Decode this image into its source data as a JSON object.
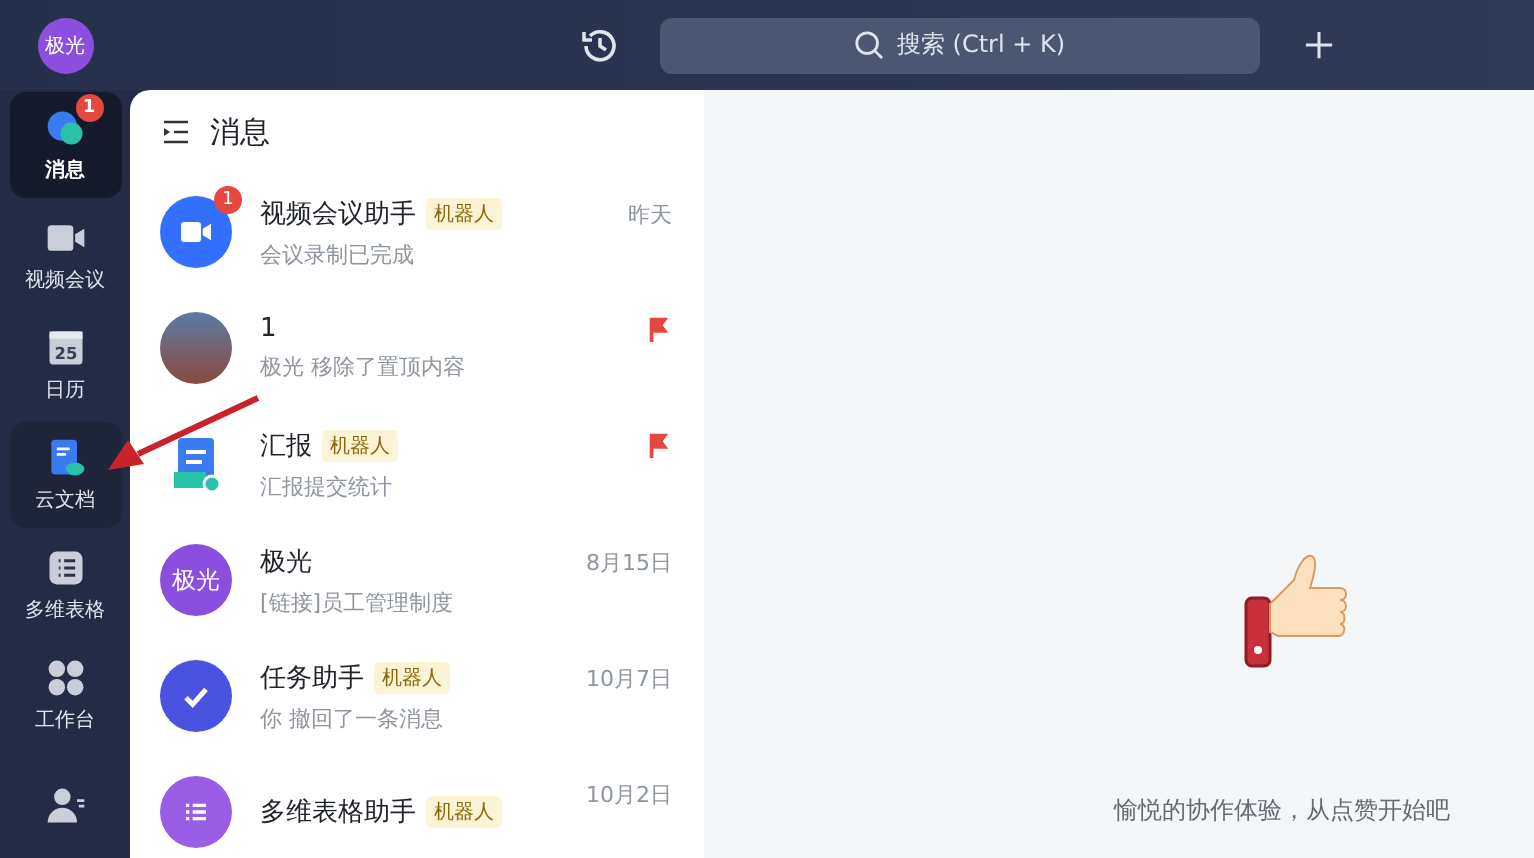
{
  "profile": {
    "initials": "极光"
  },
  "search": {
    "placeholder": "搜索 (Ctrl + K)"
  },
  "nav": [
    {
      "label": "消息",
      "kind": "chat",
      "selected": true,
      "badge": "1"
    },
    {
      "label": "视频会议",
      "kind": "video",
      "selected": false
    },
    {
      "label": "日历",
      "kind": "calendar",
      "selected": false,
      "icon_text": "25"
    },
    {
      "label": "云文档",
      "kind": "doc",
      "selected": false,
      "hover": true
    },
    {
      "label": "多维表格",
      "kind": "table",
      "selected": false
    },
    {
      "label": "工作台",
      "kind": "apps",
      "selected": false
    },
    {
      "kind": "contacts",
      "selected": false
    }
  ],
  "list_title": "消息",
  "chats": [
    {
      "name": "视频会议助手",
      "tag": "机器人",
      "preview": "会议录制已完成",
      "time": "昨天",
      "kind": "video",
      "badge": "1",
      "flagged": false
    },
    {
      "name": "1",
      "preview": "极光 移除了置顶内容",
      "kind": "photo",
      "flagged": true
    },
    {
      "name": "汇报",
      "tag": "机器人",
      "preview": "汇报提交统计",
      "kind": "report",
      "flagged": true
    },
    {
      "name": "极光",
      "preview": "[链接]员工管理制度",
      "time": "8月15日",
      "kind": "text",
      "avatar_text": "极光",
      "flagged": false
    },
    {
      "name": "任务助手",
      "tag": "机器人",
      "preview": "你 撤回了一条消息",
      "time": "10月7日",
      "kind": "task",
      "flagged": false
    },
    {
      "name": "多维表格助手",
      "tag": "机器人",
      "time": "10月2日",
      "kind": "table",
      "flagged": false
    }
  ],
  "empty_state": {
    "text": "愉悦的协作体验，从点赞开始吧"
  }
}
